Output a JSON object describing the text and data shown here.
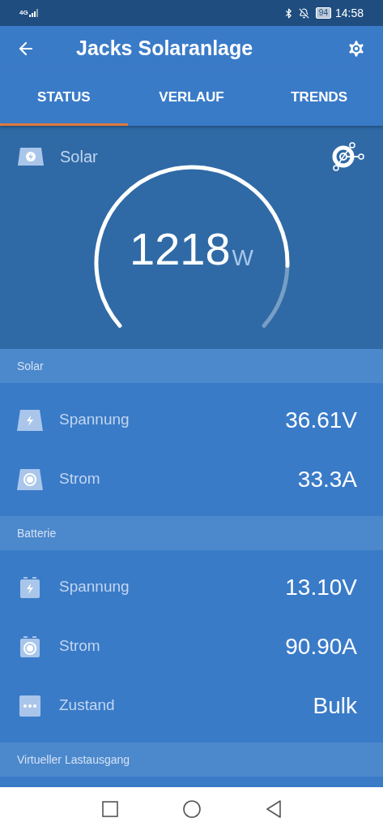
{
  "status_bar": {
    "network": "4G",
    "battery": "94",
    "time": "14:58"
  },
  "header": {
    "title": "Jacks Solaranlage"
  },
  "tabs": [
    {
      "label": "STATUS",
      "selected": true
    },
    {
      "label": "VERLAUF",
      "selected": false
    },
    {
      "label": "TRENDS",
      "selected": false
    }
  ],
  "gauge": {
    "label": "Solar",
    "value": "1218",
    "unit": "W"
  },
  "sections": [
    {
      "title": "Solar",
      "rows": [
        {
          "kind": "panel-bolt",
          "label": "Spannung",
          "value": "36.61V"
        },
        {
          "kind": "panel-dot",
          "label": "Strom",
          "value": "33.3A"
        }
      ]
    },
    {
      "title": "Batterie",
      "rows": [
        {
          "kind": "battery-bolt",
          "label": "Spannung",
          "value": "13.10V"
        },
        {
          "kind": "battery-dot",
          "label": "Strom",
          "value": "90.90A"
        },
        {
          "kind": "dots",
          "label": "Zustand",
          "value": "Bulk"
        }
      ]
    },
    {
      "title": "Virtueller Lastausgang"
    }
  ]
}
